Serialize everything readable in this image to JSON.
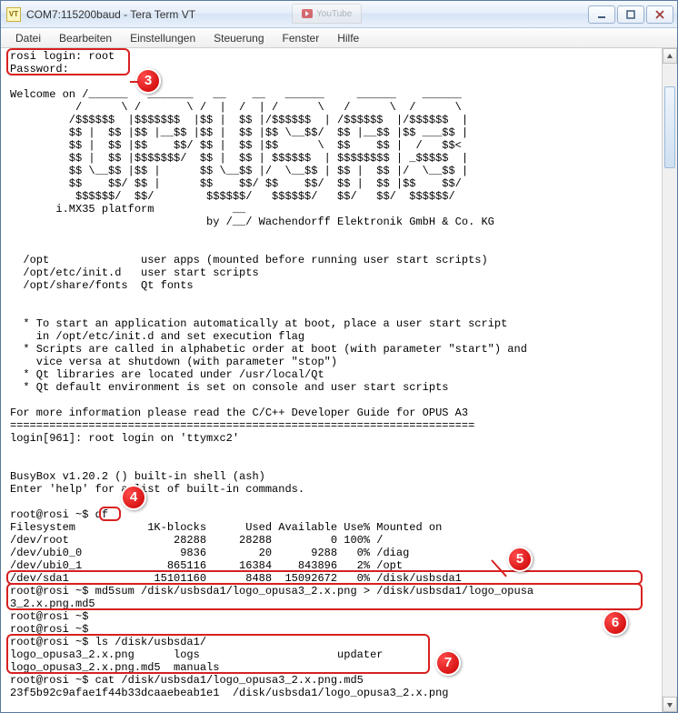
{
  "window": {
    "icon_text": "VT",
    "title": "COM7:115200baud - Tera Term VT",
    "bg_tab_label": "YouTube"
  },
  "menubar": {
    "items": [
      "Datei",
      "Bearbeiten",
      "Einstellungen",
      "Steuerung",
      "Fenster",
      "Hilfe"
    ]
  },
  "callouts": {
    "c3": "3",
    "c4": "4",
    "c5": "5",
    "c6": "6",
    "c7": "7"
  },
  "terminal": {
    "lines": [
      "rosi login: root",
      "Password:",
      "",
      "Welcome on /______   _______   __    __   ______     ______    ______",
      "          /      \\ /       \\ /  |  /  | /      \\   /      \\  /      \\",
      "         /$$$$$$  |$$$$$$$  |$$ |  $$ |/$$$$$$  | /$$$$$$  |/$$$$$$  |",
      "         $$ |  $$ |$$ |__$$ |$$ |  $$ |$$ \\__$$/  $$ |__$$ |$$ ___$$ |",
      "         $$ |  $$ |$$    $$/ $$ |  $$ |$$      \\  $$    $$ |  /   $$<",
      "         $$ |  $$ |$$$$$$$/  $$ |  $$ | $$$$$$  | $$$$$$$$ | _$$$$$  |",
      "         $$ \\__$$ |$$ |      $$ \\__$$ |/  \\__$$ | $$ |  $$ |/  \\__$$ |",
      "         $$    $$/ $$ |      $$    $$/ $$    $$/  $$ |  $$ |$$    $$/",
      "          $$$$$$/  $$/        $$$$$$/   $$$$$$/   $$/   $$/  $$$$$$/",
      "       i.MX35 platform            __",
      "                              by /__/ Wachendorff Elektronik GmbH & Co. KG",
      "",
      "",
      "  /opt              user apps (mounted before running user start scripts)",
      "  /opt/etc/init.d   user start scripts",
      "  /opt/share/fonts  Qt fonts",
      "",
      "",
      "  * To start an application automatically at boot, place a user start script",
      "    in /opt/etc/init.d and set execution flag",
      "  * Scripts are called in alphabetic order at boot (with parameter \"start\") and",
      "    vice versa at shutdown (with parameter \"stop\")",
      "  * Qt libraries are located under /usr/local/Qt",
      "  * Qt default environment is set on console and user start scripts",
      "",
      "For more information please read the C/C++ Developer Guide for OPUS A3",
      "=======================================================================",
      "login[961]: root login on 'ttymxc2'",
      "",
      "",
      "BusyBox v1.20.2 () built-in shell (ash)",
      "Enter 'help' for a list of built-in commands.",
      "",
      "root@rosi ~$ df",
      "Filesystem           1K-blocks      Used Available Use% Mounted on",
      "/dev/root                28288     28288         0 100% /",
      "/dev/ubi0_0               9836        20      9288   0% /diag",
      "/dev/ubi0_1             865116     16384    843896   2% /opt",
      "/dev/sda1             15101160      8488  15092672   0% /disk/usbsda1",
      "root@rosi ~$ md5sum /disk/usbsda1/logo_opusa3_2.x.png > /disk/usbsda1/logo_opusa",
      "3_2.x.png.md5",
      "root@rosi ~$",
      "root@rosi ~$",
      "root@rosi ~$ ls /disk/usbsda1/",
      "logo_opusa3_2.x.png      logs                     updater",
      "logo_opusa3_2.x.png.md5  manuals",
      "root@rosi ~$ cat /disk/usbsda1/logo_opusa3_2.x.png.md5",
      "23f5b92c9afae1f44b33dcaaebeab1e1  /disk/usbsda1/logo_opusa3_2.x.png"
    ]
  }
}
